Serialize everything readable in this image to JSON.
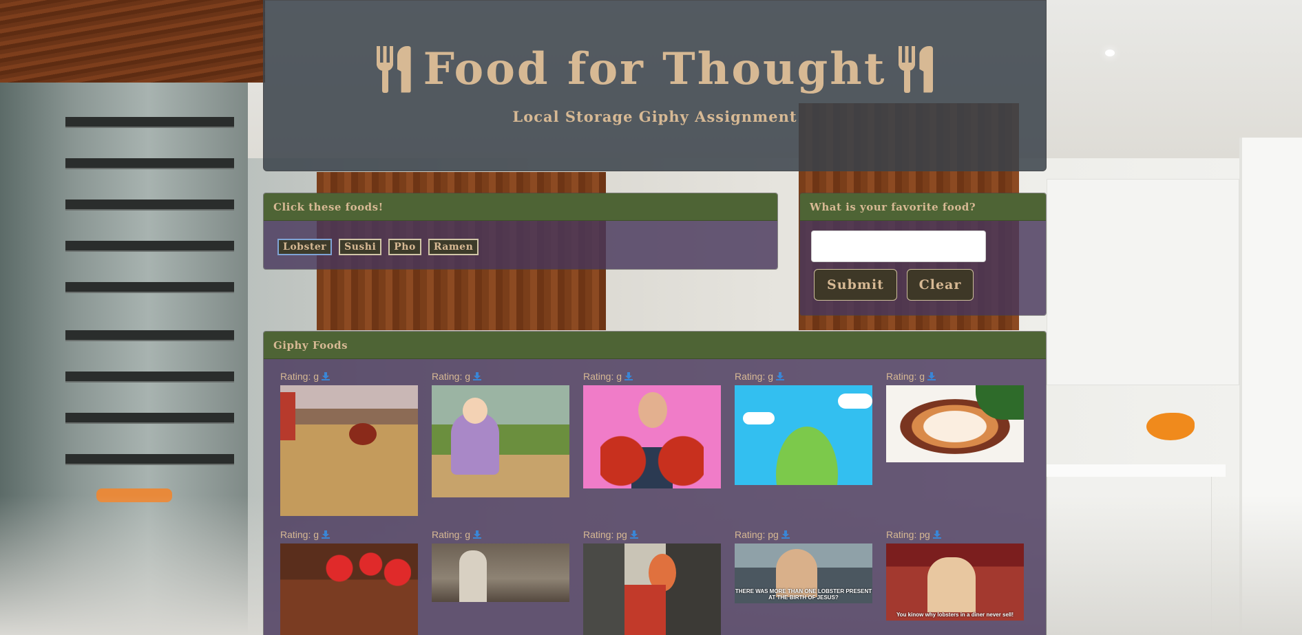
{
  "header": {
    "title": "Food for Thought",
    "subtitle": "Local Storage Giphy Assignment"
  },
  "foods_panel": {
    "heading": "Click these foods!",
    "buttons": [
      "Lobster",
      "Sushi",
      "Pho",
      "Ramen"
    ]
  },
  "favorite_panel": {
    "heading": "What is your favorite food?",
    "input_value": "",
    "submit_label": "Submit",
    "clear_label": "Clear"
  },
  "giphy_panel": {
    "heading": "Giphy Foods",
    "gifs": [
      {
        "rating": "Rating: g"
      },
      {
        "rating": "Rating: g"
      },
      {
        "rating": "Rating: g"
      },
      {
        "rating": "Rating: g"
      },
      {
        "rating": "Rating: g"
      },
      {
        "rating": "Rating: g"
      },
      {
        "rating": "Rating: g"
      },
      {
        "rating": "Rating: pg"
      },
      {
        "rating": "Rating: pg",
        "caption": "THERE WAS MORE THAN ONE LOBSTER PRESENT AT THE BIRTH OF JESUS?"
      },
      {
        "rating": "Rating: pg",
        "caption": "You kinow why lobsters in a diner never sell!"
      }
    ]
  },
  "colors": {
    "accent_text": "#d7b994",
    "panel_header": "#4e6435",
    "panel_body": "#48375c",
    "download_icon": "#3a86d6"
  },
  "icons": {
    "utensils": "utensils-icon",
    "download": "download-icon"
  }
}
